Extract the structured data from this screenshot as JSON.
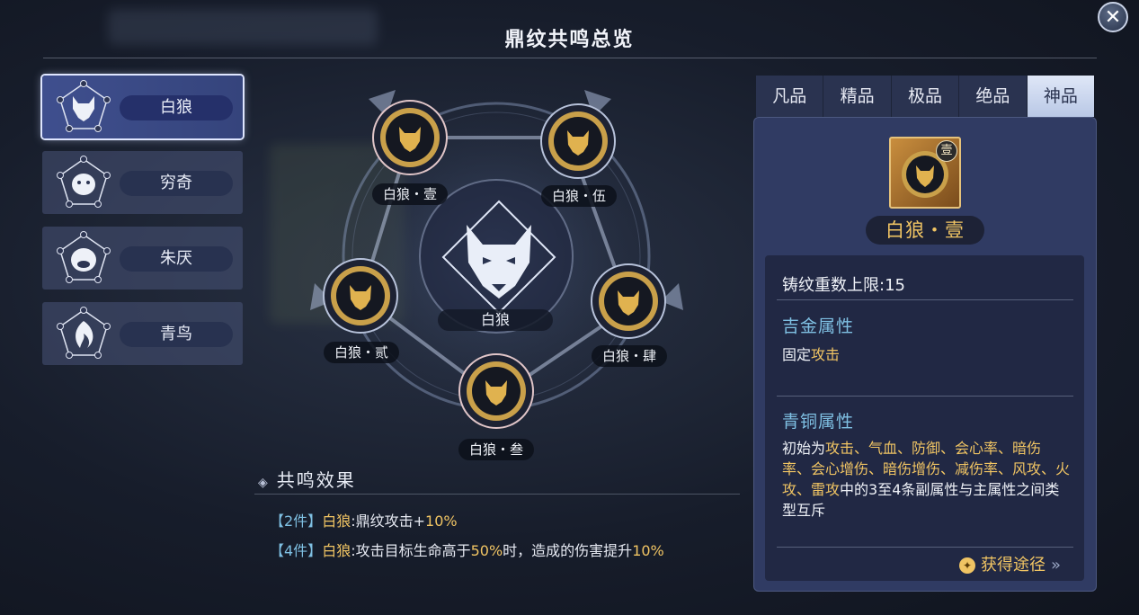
{
  "title": "鼎纹共鸣总览",
  "close_label": "✕",
  "beasts": [
    {
      "name": "白狼",
      "icon": "wolf-icon",
      "active": true
    },
    {
      "name": "穷奇",
      "icon": "tiger-icon",
      "active": false
    },
    {
      "name": "朱厌",
      "icon": "ape-icon",
      "active": false
    },
    {
      "name": "青鸟",
      "icon": "bird-icon",
      "active": false
    }
  ],
  "diagram": {
    "center_label": "白狼",
    "center_icon": "wolf-emblem-icon",
    "nodes": [
      {
        "label": "白狼・壹"
      },
      {
        "label": "白狼・伍"
      },
      {
        "label": "白狼・贰"
      },
      {
        "label": "白狼・肆"
      },
      {
        "label": "白狼・叁"
      }
    ]
  },
  "effects": {
    "title": "共鸣效果",
    "rows": [
      {
        "tag": "【2件】",
        "name": "白狼",
        "text1": ":鼎纹攻击+",
        "val1": "10%",
        "text2": "",
        "val2": ""
      },
      {
        "tag": "【4件】",
        "name": "白狼",
        "text1": ":攻击目标生命高于",
        "val1": "50%",
        "text2": "时，造成的伤害提升",
        "val2": "10%"
      }
    ]
  },
  "tabs": [
    "凡品",
    "精品",
    "极品",
    "绝品",
    "神品"
  ],
  "active_tab": "神品",
  "item": {
    "badge": "壹",
    "name": "白狼・壹",
    "cast_limit": "铸纹重数上限:15",
    "gold_attr_title": "吉金属性",
    "gold_attr_prefix": "固定",
    "gold_attr_value": "攻击",
    "bronze_attr_title": "青铜属性",
    "bronze_prefix": "初始为",
    "bronze_values": "攻击、气血、防御、会心率、暗伤率、会心增伤、暗伤增伤、减伤率、风攻、火攻、雷攻",
    "bronze_suffix": "中的3至4条副属性与主属性之间类型互斥",
    "obtain_label": "获得途径",
    "obtain_chevron": "»"
  },
  "colors": {
    "accent_gold": "#f0c463",
    "accent_cyan": "#7fc0e3",
    "panel": "#303b63"
  }
}
